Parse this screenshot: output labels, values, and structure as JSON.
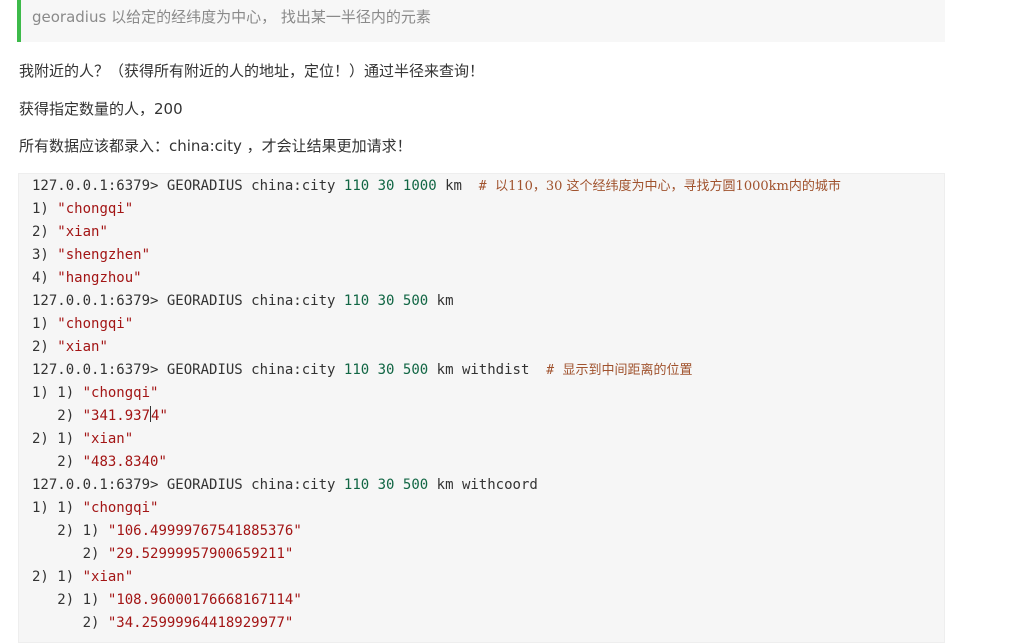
{
  "quote_text": "georadius 以给定的经纬度为中心， 找出某一半径内的元素",
  "paragraphs": [
    "我附近的人？（获得所有附近的人的地址，定位！）通过半径来查询！",
    "获得指定数量的人，200",
    "所有数据应该都录入：china:city ，才会让结果更加请求！"
  ],
  "code": {
    "prompt": "127.0.0.1:6379>",
    "cmd1": {
      "command": "GEORADIUS china:city",
      "lon": "110",
      "lat": "30",
      "radius": "1000",
      "unit": "km",
      "comment": "以110，30 这个经纬度为中心，寻找方圆1000km内的城市"
    },
    "cmd1_results": [
      {
        "idx": "1)",
        "value": "\"chongqi\""
      },
      {
        "idx": "2)",
        "value": "\"xian\""
      },
      {
        "idx": "3)",
        "value": "\"shengzhen\""
      },
      {
        "idx": "4)",
        "value": "\"hangzhou\""
      }
    ],
    "cmd2": {
      "command": "GEORADIUS china:city",
      "lon": "110",
      "lat": "30",
      "radius": "500",
      "unit": "km"
    },
    "cmd2_results": [
      {
        "idx": "1)",
        "value": "\"chongqi\""
      },
      {
        "idx": "2)",
        "value": "\"xian\""
      }
    ],
    "cmd3": {
      "command": "GEORADIUS china:city",
      "lon": "110",
      "lat": "30",
      "radius": "500",
      "unit": "km withdist",
      "comment": "显示到中间距离的位置"
    },
    "cmd3_results": [
      {
        "idx": "1) 1)",
        "name": "\"chongqi\"",
        "sub": "2)",
        "dist_a": "\"341.937",
        "dist_b": "4\""
      },
      {
        "idx": "2) 1)",
        "name": "\"xian\"",
        "sub": "2)",
        "dist": "\"483.8340\""
      }
    ],
    "cmd4": {
      "command": "GEORADIUS china:city",
      "lon": "110",
      "lat": "30",
      "radius": "500",
      "unit": "km withcoord"
    },
    "cmd4_results": [
      {
        "idx": "1) 1)",
        "name": "\"chongqi\"",
        "sub1": "2) 1)",
        "lon": "\"106.49999767541885376\"",
        "sub2": "2)",
        "lat": "\"29.52999957900659211\""
      },
      {
        "idx": "2) 1)",
        "name": "\"xian\"",
        "sub1": "2) 1)",
        "lon": "\"108.96000176668167114\"",
        "sub2": "2)",
        "lat": "\"34.25999964418929977\""
      }
    ]
  }
}
